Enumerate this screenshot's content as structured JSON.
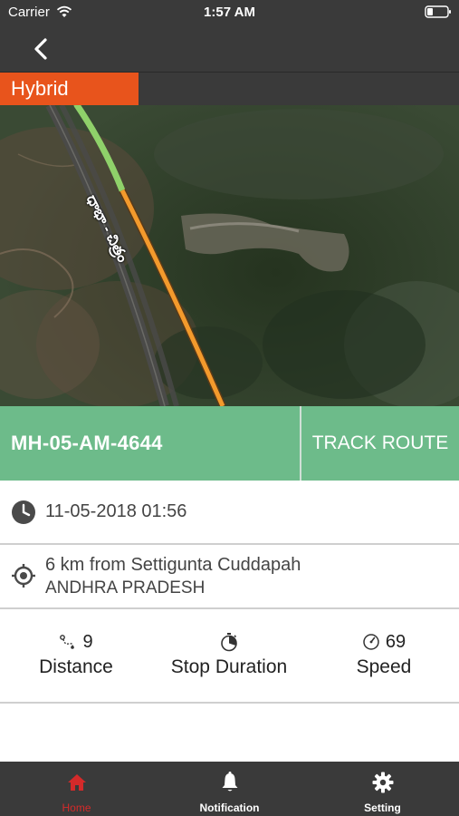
{
  "status_bar": {
    "carrier": "Carrier",
    "time": "1:57 AM",
    "icons": [
      "wifi-icon",
      "battery-icon"
    ]
  },
  "nav": {
    "back_icon": "chevron-left-icon"
  },
  "map": {
    "type_button_label": "Hybrid",
    "road_label": "ధాభా - చిత్రం"
  },
  "vehicle": {
    "number": "MH-05-AM-4644",
    "track_route_label": "TRACK ROUTE",
    "bar_color": "#6dbb8a"
  },
  "details": {
    "timestamp": "11-05-2018 01:56",
    "location_line1": "6 km from Settigunta Cuddapah",
    "location_line2": "ANDHRA PRADESH"
  },
  "stats": {
    "distance": {
      "value": "9",
      "label": "Distance",
      "icon": "route-icon"
    },
    "stop_duration": {
      "label": "Stop Duration",
      "icon": "stopwatch-icon"
    },
    "speed": {
      "value": "69",
      "label": "Speed",
      "icon": "speedometer-icon"
    }
  },
  "tabs": [
    {
      "label": "Home",
      "icon": "home-icon",
      "active": true
    },
    {
      "label": "Notification",
      "icon": "bell-icon",
      "active": false
    },
    {
      "label": "Setting",
      "icon": "gear-icon",
      "active": false
    }
  ],
  "colors": {
    "accent": "#e8541c",
    "active_tab": "#d42a2a",
    "dark_bar": "#3a3a3a"
  }
}
